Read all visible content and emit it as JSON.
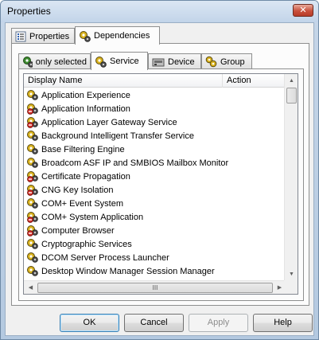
{
  "window": {
    "title": "Properties",
    "close_label": "✕"
  },
  "outer_tabs": [
    {
      "label": "Properties",
      "icon": "properties-icon"
    },
    {
      "label": "Dependencies",
      "icon": "dependencies-icon"
    }
  ],
  "inner_tabs": [
    {
      "label": "only selected",
      "icon": "gears-icon"
    },
    {
      "label": "Service",
      "icon": "gears-icon"
    },
    {
      "label": "Device",
      "icon": "device-icon"
    },
    {
      "label": "Group",
      "icon": "group-icon"
    }
  ],
  "list": {
    "columns": [
      "Display Name",
      "Action"
    ],
    "rows": [
      {
        "name": "Application Experience",
        "status": "running"
      },
      {
        "name": "Application Information",
        "status": "stopped"
      },
      {
        "name": "Application Layer Gateway Service",
        "status": "stopped"
      },
      {
        "name": "Background Intelligent Transfer Service",
        "status": "running"
      },
      {
        "name": "Base Filtering Engine",
        "status": "running"
      },
      {
        "name": "Broadcom ASF IP and SMBIOS Mailbox Monitor",
        "status": "running"
      },
      {
        "name": "Certificate Propagation",
        "status": "stopped"
      },
      {
        "name": "CNG Key Isolation",
        "status": "stopped"
      },
      {
        "name": "COM+ Event System",
        "status": "running"
      },
      {
        "name": "COM+ System Application",
        "status": "stopped"
      },
      {
        "name": "Computer Browser",
        "status": "stopped"
      },
      {
        "name": "Cryptographic Services",
        "status": "running"
      },
      {
        "name": "DCOM Server Process Launcher",
        "status": "running"
      },
      {
        "name": "Desktop Window Manager Session Manager",
        "status": "running"
      }
    ],
    "hscroll_grip": "III"
  },
  "buttons": {
    "ok": "OK",
    "cancel": "Cancel",
    "apply": "Apply",
    "help": "Help"
  },
  "colors": {
    "gear_yellow": "#d9b21c",
    "gear_dark": "#3a3a3a",
    "stopped_red": "#d8312a"
  }
}
